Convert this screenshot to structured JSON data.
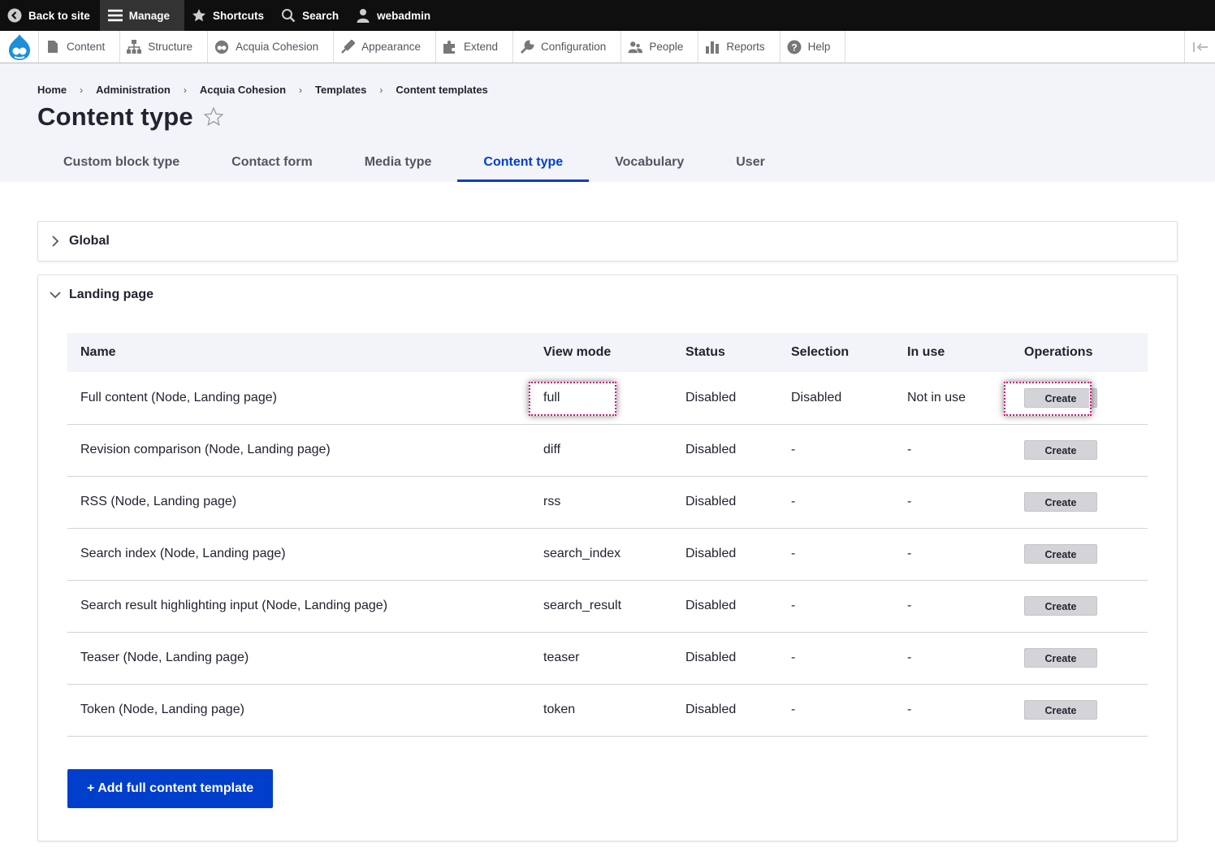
{
  "toolbar": {
    "back": "Back to site",
    "manage": "Manage",
    "shortcuts": "Shortcuts",
    "search": "Search",
    "user": "webadmin"
  },
  "tray": {
    "items": [
      {
        "label": "Content",
        "icon": "file-icon"
      },
      {
        "label": "Structure",
        "icon": "sitemap-icon"
      },
      {
        "label": "Acquia Cohesion",
        "icon": "cohesion-icon"
      },
      {
        "label": "Appearance",
        "icon": "paintbrush-icon"
      },
      {
        "label": "Extend",
        "icon": "puzzle-icon"
      },
      {
        "label": "Configuration",
        "icon": "wrench-icon"
      },
      {
        "label": "People",
        "icon": "people-icon"
      },
      {
        "label": "Reports",
        "icon": "bar-chart-icon"
      },
      {
        "label": "Help",
        "icon": "help-icon"
      }
    ]
  },
  "breadcrumb": [
    "Home",
    "Administration",
    "Acquia Cohesion",
    "Templates",
    "Content templates"
  ],
  "page_title": "Content type",
  "tabs": [
    "Custom block type",
    "Contact form",
    "Media type",
    "Content type",
    "Vocabulary",
    "User"
  ],
  "active_tab": 3,
  "sections": {
    "global": "Global",
    "landing": "Landing page"
  },
  "table": {
    "headers": [
      "Name",
      "View mode",
      "Status",
      "Selection",
      "In use",
      "Operations"
    ],
    "rows": [
      [
        "Full content (Node, Landing page)",
        "full",
        "Disabled",
        "Disabled",
        "Not in use",
        "Create"
      ],
      [
        "Revision comparison (Node, Landing page)",
        "diff",
        "Disabled",
        "-",
        "-",
        "Create"
      ],
      [
        "RSS (Node, Landing page)",
        "rss",
        "Disabled",
        "-",
        "-",
        "Create"
      ],
      [
        "Search index (Node, Landing page)",
        "search_index",
        "Disabled",
        "-",
        "-",
        "Create"
      ],
      [
        "Search result highlighting input (Node, Landing page)",
        "search_result",
        "Disabled",
        "-",
        "-",
        "Create"
      ],
      [
        "Teaser (Node, Landing page)",
        "teaser",
        "Disabled",
        "-",
        "-",
        "Create"
      ],
      [
        "Token (Node, Landing page)",
        "token",
        "Disabled",
        "-",
        "-",
        "Create"
      ]
    ]
  },
  "add_button": "+ Add full content template",
  "colors": {
    "accent": "#003ecc",
    "highlight": "#d0157a"
  }
}
